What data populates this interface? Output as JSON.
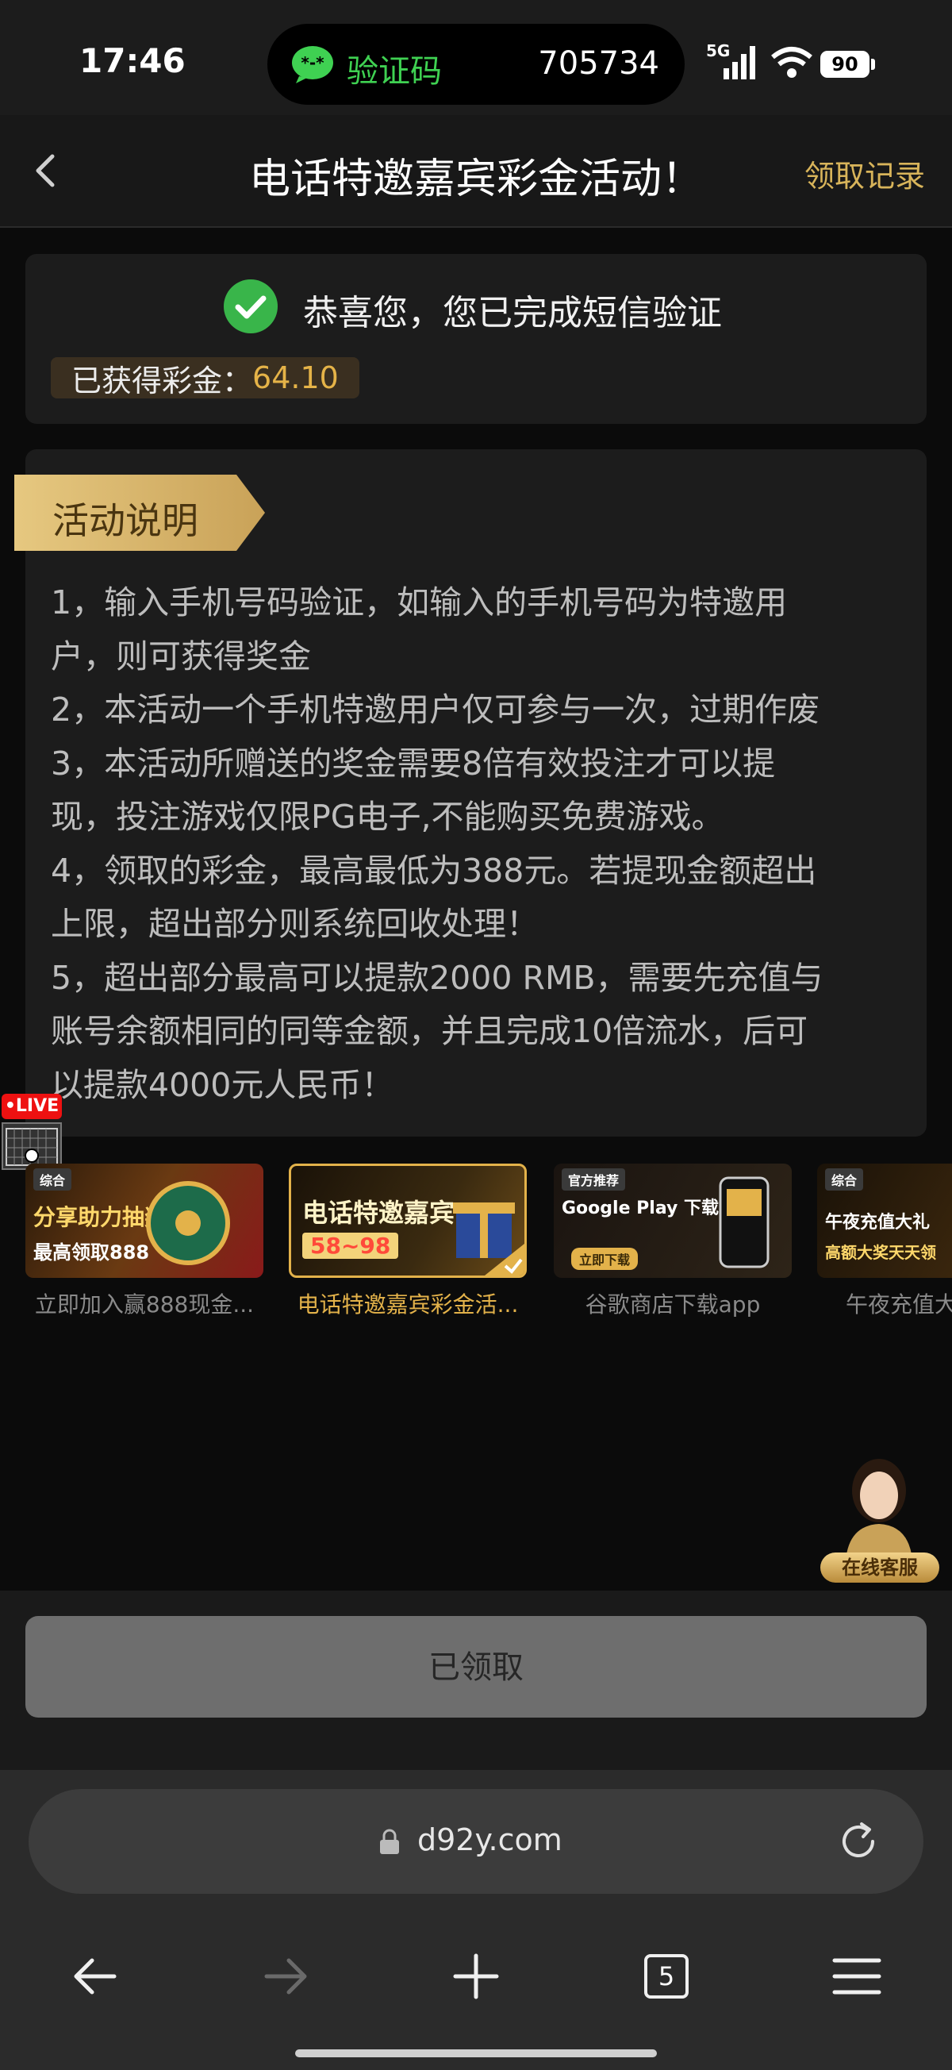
{
  "status_bar": {
    "time": "17:46",
    "island_label": "验证码",
    "island_code": "705734",
    "network": "5G",
    "battery": "90"
  },
  "header": {
    "title": "电话特邀嘉宾彩金活动！",
    "records_label": "领取记录"
  },
  "success": {
    "message": "恭喜您，您已完成短信验证",
    "bonus_label": "已获得彩金：",
    "bonus_value": "64.10"
  },
  "description": {
    "title": "活动说明",
    "lines": [
      "1，输入手机号码验证，如输入的手机号码为特邀用",
      "户，则可获得奖金",
      "2，本活动一个手机特邀用户仅可参与一次，过期作废",
      "3，本活动所赠送的奖金需要8倍有效投注才可以提",
      "现，投注游戏仅限PG电子,不能购买免费游戏。",
      "4，领取的彩金，最高最低为388元。若提现金额超出",
      "上限，超出部分则系统回收处理！",
      "5，超出部分最高可以提款2000 RMB，需要先充值与",
      "账号余额相同的同等金额，并且完成10倍流水，后可",
      "以提款4000元人民币！"
    ]
  },
  "live_badge": "•LIVE",
  "promos": [
    {
      "caption": "立即加入赢888现金...",
      "thumb_tag": "综合",
      "thumb_text": "分享助力抽奖",
      "thumb_sub": "最高领取888"
    },
    {
      "caption": "电话特邀嘉宾彩金活...",
      "thumb_text": "电话特邀嘉宾",
      "thumb_sub": "58~98"
    },
    {
      "caption": "谷歌商店下载app",
      "thumb_tag": "官方推荐",
      "thumb_text": "Google Play 下载",
      "thumb_sub": "立即下载"
    },
    {
      "caption": "午夜充值大礼包",
      "thumb_tag": "综合",
      "thumb_text": "午夜充值大礼",
      "thumb_sub": "高额大奖天天领"
    }
  ],
  "customer_service": "在线客服",
  "action": {
    "claimed_label": "已领取"
  },
  "browser": {
    "url": "d92y.com",
    "tab_count": "5"
  },
  "colors": {
    "accent_gold": "#e3b24a",
    "success_green": "#39b54a",
    "background": "#0b0b0b"
  }
}
